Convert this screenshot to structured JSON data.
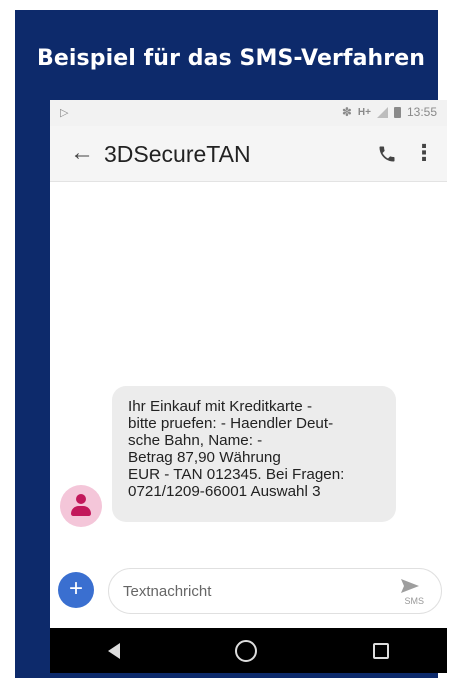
{
  "heading": "Beispiel für das SMS-Verfahren",
  "status_bar": {
    "time": "13:55",
    "network": "H+"
  },
  "app_bar": {
    "title": "3DSecureTAN"
  },
  "message": {
    "lines": [
      "Ihr Einkauf mit Kreditkarte -",
      "bitte pruefen: - Haendler Deut-",
      "sche Bahn, Name: -",
      "Betrag 87,90 Währung",
      "EUR - TAN 012345. Bei Fragen:",
      "0721/1209-66001 Auswahl 3"
    ]
  },
  "composer": {
    "placeholder": "Textnachricht",
    "send_label": "SMS",
    "value": ""
  },
  "icons": {
    "back": "arrow-left-icon",
    "call": "phone-icon",
    "more": "more-vertical-icon",
    "avatar": "person-icon",
    "add": "plus-icon",
    "send": "send-icon",
    "nav_back": "triangle-back-icon",
    "nav_home": "circle-home-icon",
    "nav_recent": "square-recent-icon"
  },
  "colors": {
    "frame": "#0d2a6b",
    "accent": "#3a6fd0",
    "avatar_bg": "#f4c6d9",
    "avatar_fg": "#c2185b"
  }
}
